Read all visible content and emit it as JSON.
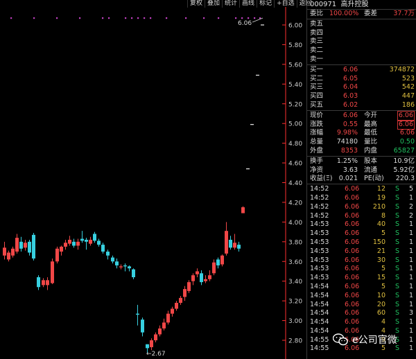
{
  "toolbar": {
    "items": [
      "复权",
      "叠加",
      "统计",
      "画线",
      "标记",
      "+自选",
      "返回"
    ]
  },
  "chart": {
    "y_ticks": [
      "6.00",
      "5.80",
      "5.60",
      "5.40",
      "5.20",
      "5.00",
      "4.80",
      "4.60",
      "4.40",
      "4.20",
      "4.00",
      "3.80",
      "3.60",
      "3.40",
      "3.20",
      "3.00",
      "2.80"
    ],
    "high_label": "6.06",
    "low_label": "2.67",
    "low_arrow": "←",
    "colors": {
      "up": "#f14747",
      "down": "#37d0e0",
      "axis": "#ff3030",
      "marker": "#c040c0"
    }
  },
  "stock": {
    "code": "000971",
    "name": "高升控股"
  },
  "stats": {
    "wb_label": "委比",
    "wb_value": "100.00%",
    "wc_label": "委差",
    "wc_value": "37.7万"
  },
  "sell": [
    {
      "label": "卖五"
    },
    {
      "label": "卖四"
    },
    {
      "label": "卖三"
    },
    {
      "label": "卖二"
    },
    {
      "label": "卖一"
    }
  ],
  "buy": [
    {
      "label": "买一",
      "price": "6.06",
      "vol": "374872"
    },
    {
      "label": "买二",
      "price": "6.05",
      "vol": "523"
    },
    {
      "label": "买三",
      "price": "6.04",
      "vol": "542"
    },
    {
      "label": "买四",
      "price": "6.03",
      "vol": "447"
    },
    {
      "label": "买五",
      "price": "6.02",
      "vol": "186"
    }
  ],
  "info": [
    [
      {
        "l": "现价",
        "v": "6.06",
        "c": "red"
      },
      {
        "l": "今开",
        "v": "6.06",
        "c": "red",
        "box": true
      }
    ],
    [
      {
        "l": "涨跌",
        "v": "0.55",
        "c": "red"
      },
      {
        "l": "最高",
        "v": "6.06",
        "c": "red",
        "box": true
      }
    ],
    [
      {
        "l": "涨幅",
        "v": "9.98%",
        "c": "red"
      },
      {
        "l": "最低",
        "v": "6.06",
        "c": "red"
      }
    ],
    [
      {
        "l": "总量",
        "v": "74180",
        "c": "white"
      },
      {
        "l": "量比",
        "v": "0.50",
        "c": "green"
      }
    ],
    [
      {
        "l": "外盘",
        "v": "8353",
        "c": "red"
      },
      {
        "l": "内盘",
        "v": "65827",
        "c": "green"
      }
    ]
  ],
  "info2": [
    [
      {
        "l": "换手",
        "v": "1.25%"
      },
      {
        "l": "股本",
        "v": "10.9亿"
      }
    ],
    [
      {
        "l": "净资",
        "v": "3.63"
      },
      {
        "l": "流通",
        "v": "5.92亿"
      }
    ],
    [
      {
        "l": "收益(Ξ)",
        "v": "0.021"
      },
      {
        "l": "PE(动)",
        "v": "220.3"
      }
    ]
  ],
  "ticks": [
    {
      "t": "14:52",
      "p": "6.06",
      "v": "12",
      "s": "S",
      "n": "5"
    },
    {
      "t": "14:52",
      "p": "6.06",
      "v": "19",
      "s": "S",
      "n": "1"
    },
    {
      "t": "14:52",
      "p": "6.06",
      "v": "210",
      "s": "S",
      "n": "2"
    },
    {
      "t": "14:52",
      "p": "6.06",
      "v": "8",
      "s": "S",
      "n": "2"
    },
    {
      "t": "14:53",
      "p": "6.06",
      "v": "40",
      "s": "S",
      "n": "1"
    },
    {
      "t": "14:53",
      "p": "6.06",
      "v": "5",
      "s": "S",
      "n": "1"
    },
    {
      "t": "14:53",
      "p": "6.06",
      "v": "150",
      "s": "S",
      "n": "1"
    },
    {
      "t": "14:53",
      "p": "6.06",
      "v": "21",
      "s": "S",
      "n": "1"
    },
    {
      "t": "14:53",
      "p": "6.06",
      "v": "30",
      "s": "S",
      "n": "1"
    },
    {
      "t": "14:53",
      "p": "6.06",
      "v": "5",
      "s": "S",
      "n": "1"
    },
    {
      "t": "14:53",
      "p": "6.06",
      "v": "15",
      "s": "S",
      "n": "1"
    },
    {
      "t": "14:54",
      "p": "6.06",
      "v": "5",
      "s": "S",
      "n": "1"
    },
    {
      "t": "14:54",
      "p": "6.06",
      "v": "10",
      "s": "S",
      "n": "1"
    },
    {
      "t": "14:54",
      "p": "6.06",
      "v": "20",
      "s": "S",
      "n": "1"
    },
    {
      "t": "14:54",
      "p": "6.06",
      "v": "60",
      "s": "S",
      "n": "3"
    },
    {
      "t": "14:54",
      "p": "6.06",
      "v": "4",
      "s": "S",
      "n": "1"
    },
    {
      "t": "14:54",
      "p": "6.06",
      "v": "4",
      "s": "S",
      "n": "1"
    },
    {
      "t": "14:55",
      "p": "6.06",
      "v": "9",
      "s": "S",
      "n": "1"
    },
    {
      "t": "14:55",
      "p": "6.06",
      "v": "5",
      "s": "S",
      "n": "1"
    }
  ],
  "watermark": {
    "text": "e公司官微"
  }
}
